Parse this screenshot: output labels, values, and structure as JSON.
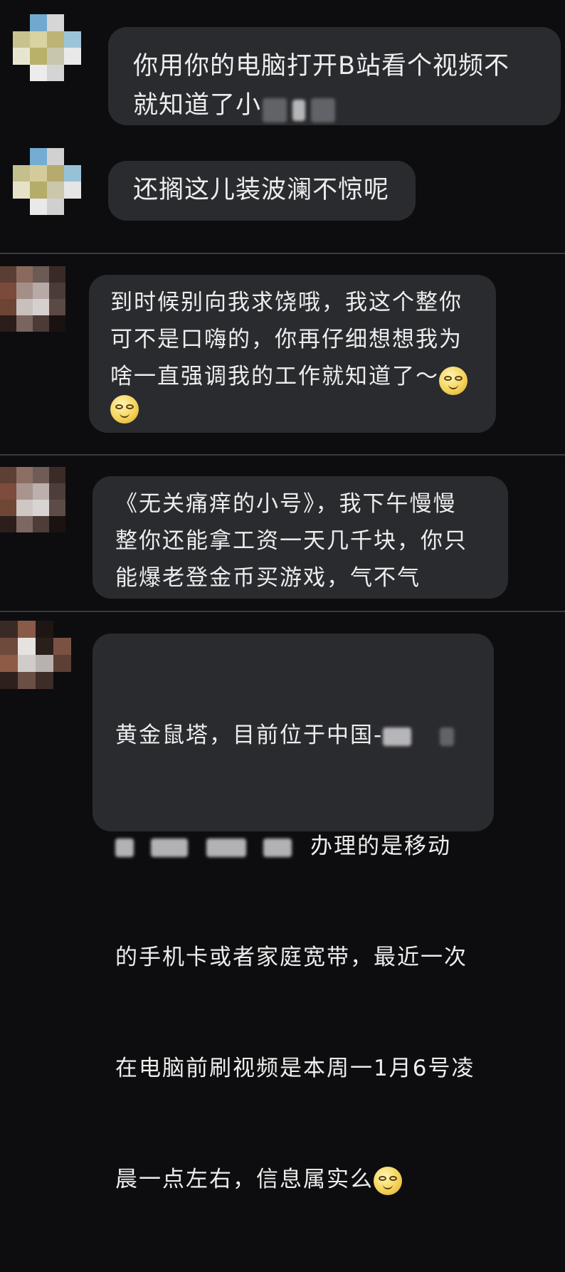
{
  "colors": {
    "background": "#0d0d0f",
    "bubble": "#2a2b2f",
    "text": "#ededed",
    "divider": "#3a3b40"
  },
  "messages": [
    {
      "text": "你用你的电脑打开B站看个视频不\n就知道了小"
    },
    {
      "text": "还搁这儿装波澜不惊呢"
    },
    {
      "text": "到时候别向我求饶哦，我这个整你\n可不是口嗨的，你再仔细想想我为\n啥一直强调我的工作就知道了～"
    },
    {
      "text": "《无关痛痒的小号》，我下午慢慢\n整你还能拿工资一天几千块，你只\n能爆老登金币买游戏，气不气"
    },
    {
      "line1": "黄金鼠塔，目前位于中国-",
      "line2": "办理的是移动",
      "line3": "的手机卡或者家庭宽带，最近一次",
      "line4": "在电脑前刷视频是本周一1月6号凌",
      "line5": "晨一点左右，信息属实么"
    }
  ],
  "icons": {
    "emoji": "grinning-face-emoji",
    "avatar": "pixelated-avatar"
  }
}
